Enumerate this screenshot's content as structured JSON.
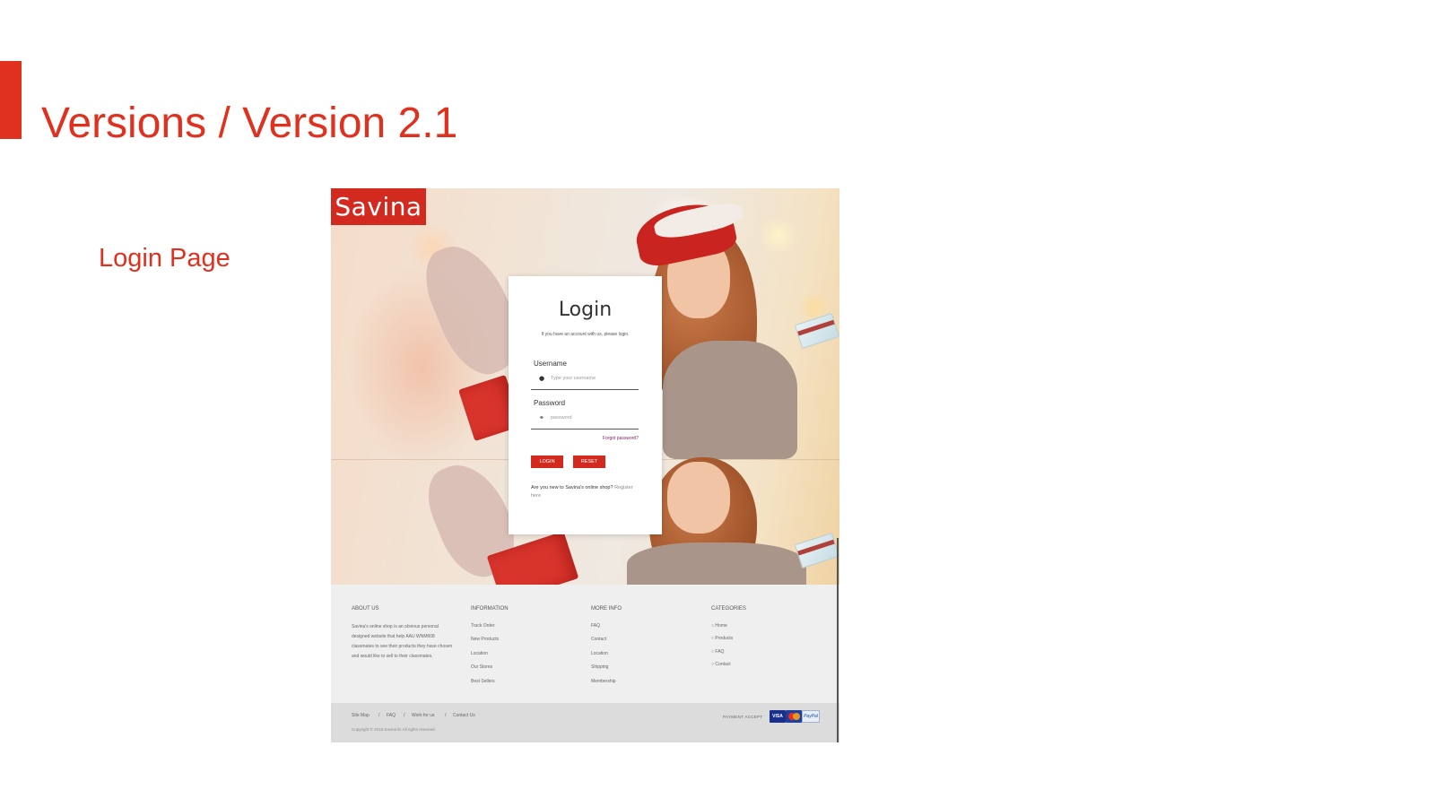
{
  "slide": {
    "title": "Versions / Version 2.1",
    "section_label": "Login Page",
    "accent_color": "#e0301e"
  },
  "mockup": {
    "logo": "Savina",
    "brand_color": "#d32a1f",
    "login": {
      "title": "Login",
      "subtitle": "If you have an account with us, please login.",
      "username_label": "Username",
      "username_placeholder": "Type your username",
      "password_label": "Password",
      "password_placeholder": "password",
      "forgot": "Forgot password?",
      "login_button": "LOGIN",
      "reset_button": "RESET",
      "register_text": "Are you new to Savina's online shop?",
      "register_link": "Register here"
    },
    "footer": {
      "columns": [
        {
          "heading": "ABOUT US",
          "text": "Savina's online shop is an obvious personal designed website that help AAU WNM608 classmates to see their products they have chosen and would like to sell to their classmates."
        },
        {
          "heading": "INFORMATION",
          "links": [
            "Track Order",
            "New Products",
            "Location",
            "Our Stores",
            "Best Sellers"
          ]
        },
        {
          "heading": "MORE INFO",
          "links": [
            "FAQ",
            "Contact",
            "Location",
            "Shipping",
            "Membership"
          ]
        },
        {
          "heading": "CATEGORIES",
          "links": [
            "Home",
            "Products",
            "FAQ",
            "Contact"
          ]
        }
      ],
      "bottom_links": [
        "Site Map",
        "FAQ",
        "Work for us",
        "Contact Us"
      ],
      "separator": "/",
      "copyright": "Copyright © 2018 Savina llc All rights reserved.",
      "payment_label": "PAYMENT ACCEPT",
      "payment_cards": [
        "VISA",
        "",
        "PayPal"
      ]
    }
  }
}
